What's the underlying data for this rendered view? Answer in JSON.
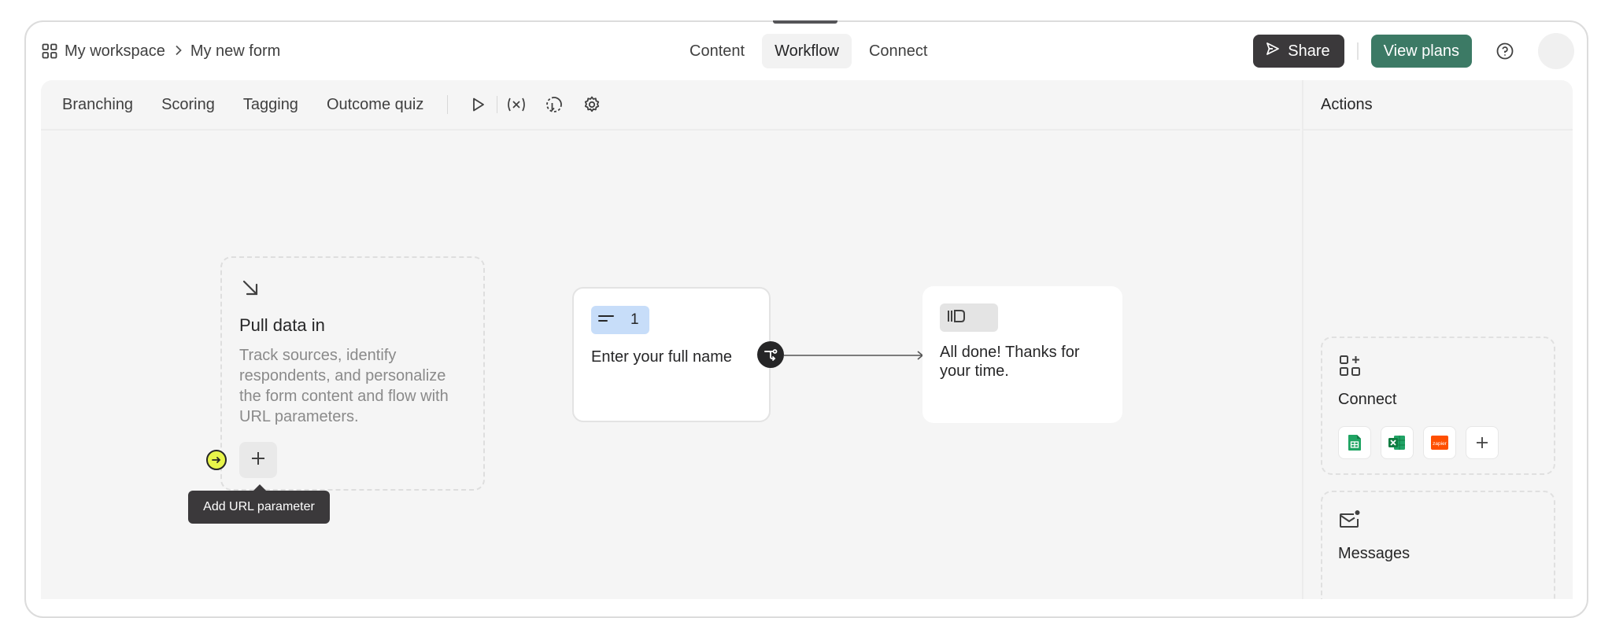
{
  "breadcrumb": {
    "workspace": "My workspace",
    "form": "My new form"
  },
  "tabs": [
    "Content",
    "Workflow",
    "Connect"
  ],
  "active_tab": "Workflow",
  "header": {
    "share_label": "Share",
    "plans_label": "View plans"
  },
  "toolbar": {
    "items": [
      "Branching",
      "Scoring",
      "Tagging",
      "Outcome quiz"
    ],
    "icons": [
      "play-icon",
      "variable-icon",
      "logic-loop-icon",
      "settings-icon"
    ]
  },
  "actions": {
    "title": "Actions",
    "connect_label": "Connect",
    "messages_label": "Messages",
    "integrations": [
      "google-sheets-icon",
      "excel-icon",
      "zapier-icon",
      "add-icon"
    ],
    "zapier_text": "zapier"
  },
  "pull_data": {
    "title": "Pull data in",
    "description": "Track sources, identify respondents, and personalize the form content and flow with URL parameters.",
    "tooltip": "Add URL parameter"
  },
  "question": {
    "number": "1",
    "text": "Enter your full name"
  },
  "ending": {
    "text": "All done! Thanks for your time."
  },
  "colors": {
    "share_bg": "#3b393b",
    "plans_bg": "#3c7a65",
    "question_badge": "#c7ddf9",
    "entry_dot": "#e8f54a"
  }
}
